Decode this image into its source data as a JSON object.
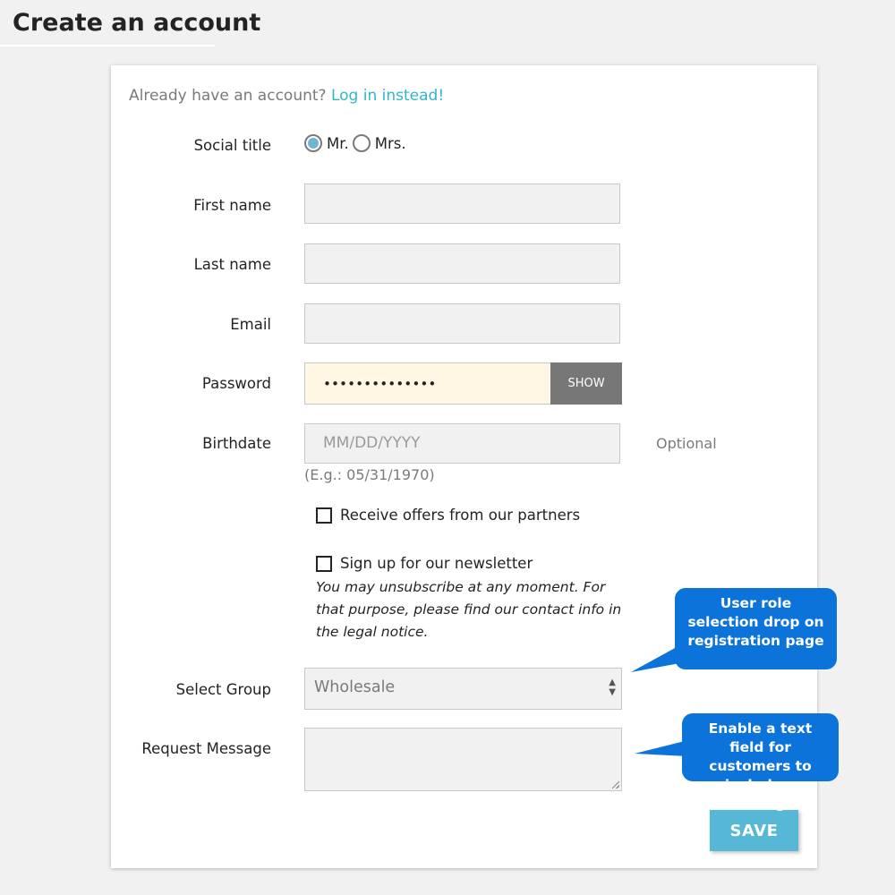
{
  "page": {
    "title": "Create an account"
  },
  "login_prompt": {
    "text": "Already have an account?",
    "link": "Log in instead!"
  },
  "form": {
    "social_title": {
      "label": "Social title",
      "options": [
        "Mr.",
        "Mrs."
      ],
      "selected": "Mr."
    },
    "first_name": {
      "label": "First name",
      "value": ""
    },
    "last_name": {
      "label": "Last name",
      "value": ""
    },
    "email": {
      "label": "Email",
      "value": ""
    },
    "password": {
      "label": "Password",
      "value": "••••••••••••••",
      "show_label": "SHOW"
    },
    "birthdate": {
      "label": "Birthdate",
      "placeholder": "MM/DD/YYYY",
      "optional": "Optional",
      "hint": "(E.g.: 05/31/1970)"
    },
    "offers": {
      "label": "Receive offers from our partners",
      "checked": false
    },
    "newsletter": {
      "label": "Sign up for our newsletter",
      "checked": false,
      "note": "You may unsubscribe at any moment. For that purpose, please find our contact info in the legal notice."
    },
    "group": {
      "label": "Select Group",
      "value": "Wholesale"
    },
    "request_message": {
      "label": "Request Message",
      "value": ""
    },
    "save_label": "SAVE"
  },
  "callouts": {
    "role": "User role selection drop on registration page",
    "message": "Enable a text field for customers to include a message"
  },
  "colors": {
    "link": "#2fb5d2",
    "save": "#56b8d6",
    "callout": "#0b73d9",
    "password_bg": "#fff7e4"
  }
}
